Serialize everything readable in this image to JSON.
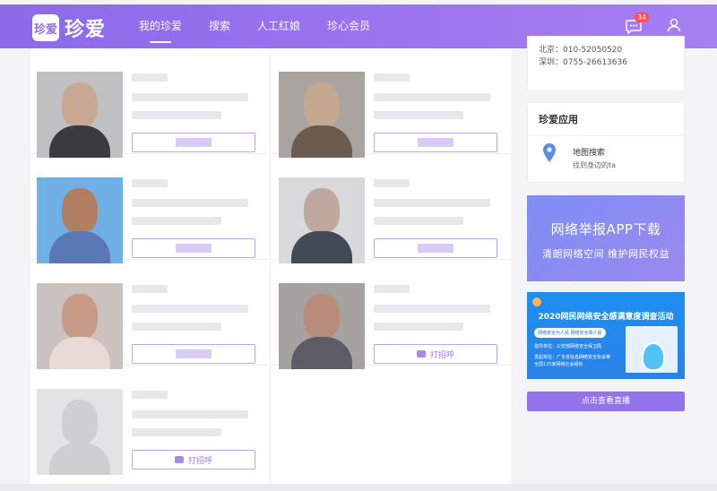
{
  "header": {
    "logo_badge": "珍爱",
    "logo_text": "珍爱",
    "nav": [
      {
        "label": "我的珍爱",
        "active": true
      },
      {
        "label": "搜索",
        "active": false
      },
      {
        "label": "人工红娘",
        "active": false
      },
      {
        "label": "珍心会员",
        "active": false
      }
    ],
    "message_count": "34",
    "icons": [
      "chat-icon",
      "user-icon"
    ]
  },
  "cards": [
    {
      "photo": [
        "#bfc0c2",
        "#c9a893",
        "#3a3a40"
      ],
      "greet_label": ""
    },
    {
      "photo": [
        "#a9a4a0",
        "#c4a88f",
        "#6b5a4e"
      ],
      "greet_label": ""
    },
    {
      "photo": [
        "#6fb0e6",
        "#b27e62",
        "#5a78b5"
      ],
      "greet_label": ""
    },
    {
      "photo": [
        "#d9d9dc",
        "#bfa89d",
        "#444a55"
      ],
      "greet_label": ""
    },
    {
      "photo": [
        "#c9c2bf",
        "#c79b88",
        "#e8d9d4"
      ],
      "greet_label": ""
    },
    {
      "photo": [
        "#a6a2a0",
        "#b98c79",
        "#5c5c64"
      ],
      "greet_label": "打招呼"
    },
    {
      "photo": [
        "#e3e3e6",
        "#cfcfd2",
        "#cfcfd2"
      ],
      "greet_label": "打招呼"
    }
  ],
  "sidebar": {
    "contact": {
      "beijing": "北京：010-52050520",
      "shenzhen": "深圳：0755-26613636"
    },
    "apps": {
      "title": "珍爱应用",
      "item_name": "地图搜索",
      "item_sub": "找到身边的ta"
    },
    "banner_report": {
      "title": "网络举报APP下载",
      "subtitle": "清朗网络空间 维护网民权益"
    },
    "banner_survey": {
      "title": "2020网民网络安全感满意度调查活动",
      "pill": "网络安全为人民 网络安全靠人民",
      "line1": "指导单位：公安部网络安全保卫局",
      "line2": "发起单位：广东省信息网络安全协会等",
      "line3": "全国135家网络社会组织"
    },
    "live_button": "点击查看直播"
  }
}
